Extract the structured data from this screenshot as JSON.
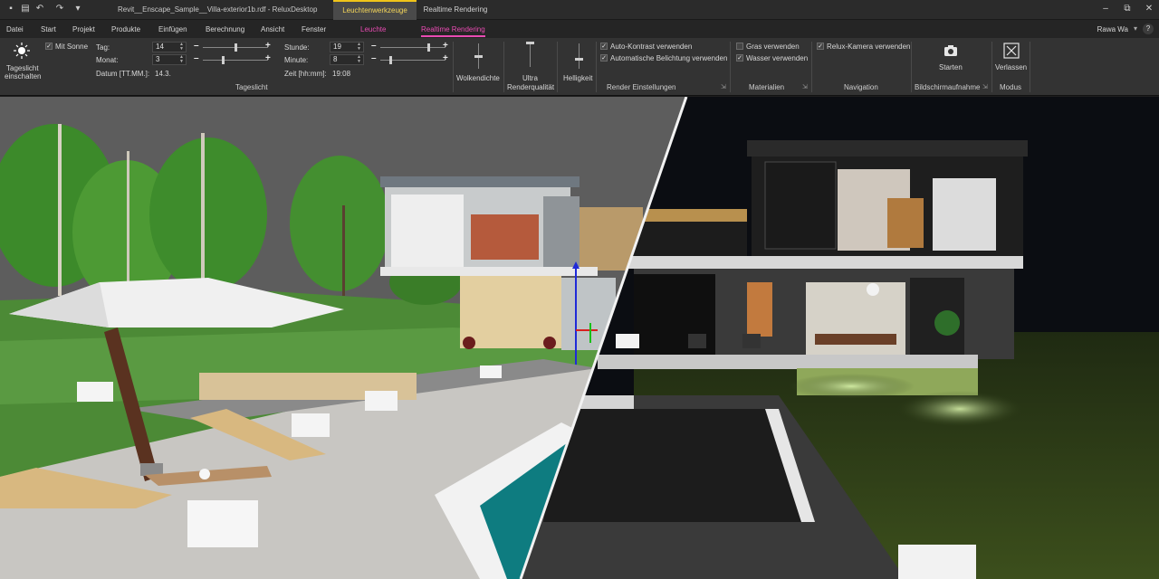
{
  "titlebar": {
    "document_title": "Revit__Enscape_Sample__Villa-exterior1b.rdf - ReluxDesktop",
    "context_tabs": [
      "Leuchtenwerkzeuge",
      "Realtime Rendering"
    ],
    "window_controls": [
      "–",
      "⧉",
      "✕"
    ]
  },
  "menubar": {
    "items": [
      "Datei",
      "Start",
      "Projekt",
      "Produkte",
      "Einfügen",
      "Berechnung",
      "Ansicht",
      "Fenster"
    ],
    "context_items": [
      "Leuchte",
      "Realtime Rendering"
    ],
    "user": "Rawa Wa"
  },
  "ribbon": {
    "tageslicht": {
      "button_label_1": "Tageslicht",
      "button_label_2": "einschalten",
      "mit_sonne": "Mit Sonne",
      "tag_label": "Tag:",
      "tag_value": "14",
      "monat_label": "Monat:",
      "monat_value": "3",
      "datum_label": "Datum [TT.MM.]:",
      "datum_value": "14.3.",
      "stunde_label": "Stunde:",
      "stunde_value": "19",
      "minute_label": "Minute:",
      "minute_value": "8",
      "zeit_label": "Zeit [hh:mm]:",
      "zeit_value": "19:08",
      "group_label": "Tageslicht",
      "tag_slider_level": 0.5,
      "monat_slider_level": 0.3,
      "stunde_slider_level": 0.75,
      "minute_slider_level": 0.15
    },
    "wolkendichte": {
      "label": "Wolkendichte",
      "level": 0.5
    },
    "renderqualitaet": {
      "label_1": "Ultra",
      "label_2": "Renderqualität",
      "level": 0.0
    },
    "helligkeit": {
      "label": "Helligkeit",
      "level": 0.65
    },
    "render_einstellungen": {
      "auto_kontrast": "Auto-Kontrast verwenden",
      "auto_belichtung": "Automatische Belichtung verwenden",
      "group_label": "Render Einstellungen"
    },
    "materialien": {
      "gras": "Gras verwenden",
      "wasser": "Wasser verwenden",
      "group_label": "Materialien"
    },
    "navigation": {
      "relux_kamera": "Relux-Kamera verwenden",
      "group_label": "Navigation"
    },
    "bildschirmaufnahme": {
      "button_label": "Starten",
      "group_label": "Bildschirmaufnahme"
    },
    "modus": {
      "button_label": "Verlassen",
      "group_label": "Modus"
    },
    "launcher_glyph": "⇲",
    "check_glyph": "✓"
  }
}
